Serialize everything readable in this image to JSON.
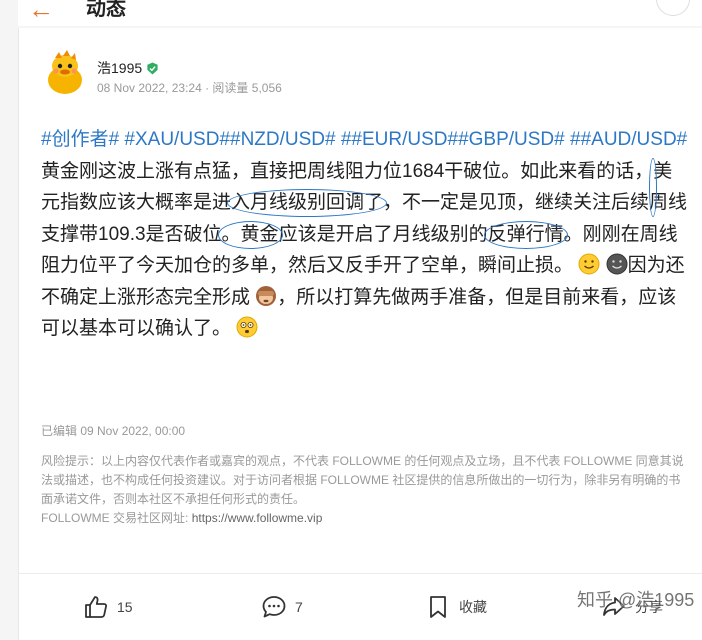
{
  "header": {
    "title": "动态",
    "back_icon": "arrow-left-icon",
    "more_icon": "ellipsis-icon"
  },
  "author": {
    "name": "浩1995",
    "verified_icon": "verified-badge-icon"
  },
  "meta": {
    "date": "08 Nov 2022, 23:24",
    "separator": " · ",
    "views_label": "阅读量",
    "views": "5,056"
  },
  "post": {
    "tags_line1": "#创作者# #XAU/USD##NZD/USD# ##EUR/USD##GBP/USD#",
    "tag_aud": "##AUD/USD#",
    "t1": " 黄金刚这波上涨有点猛，直接把周线阻力位1684干破位。如此来看的话，",
    "c1": "美元指数",
    "t2": "应该大概率是进",
    "c2": "入月线级别回调了",
    "t3": "，不一定是见顶，继续关注后续周线支撑带109.3是否破位",
    "c3": "。黄金",
    "t4": "应该是开启了月线级别的",
    "c4": "反弹行情",
    "t5": "。刚刚在周线阻力位平了今天加仓的多单，然后又反手开了空单，瞬间止损。",
    "t6": "因为还不确定上涨形态完全形成",
    "t7": "，所以打算先做两手准备，但是目前来看，应该可以基本可以确认了。"
  },
  "edited": "已编辑 09 Nov 2022, 00:00",
  "disclaimer": {
    "text": "风险提示：以上内容仅代表作者或嘉宾的观点，不代表 FOLLOWME 的任何观点及立场，且不代表 FOLLOWME 同意其说法或描述，也不构成任何投资建议。对于访问者根据 FOLLOWME 社区提供的信息所做出的一切行为，除非另有明确的书面承诺文件，否则本社区不承担任何形式的责任。",
    "site_label": "FOLLOWME 交易社区网址: ",
    "site_url": "https://www.followme.vip"
  },
  "actions": {
    "likes": "15",
    "comments": "7",
    "favorite_label": "收藏",
    "share_label": "分享"
  },
  "watermark": "知乎 @浩1995",
  "colors": {
    "tag": "#2d78c6",
    "accent": "#e8742a",
    "verified": "#2fae62"
  }
}
